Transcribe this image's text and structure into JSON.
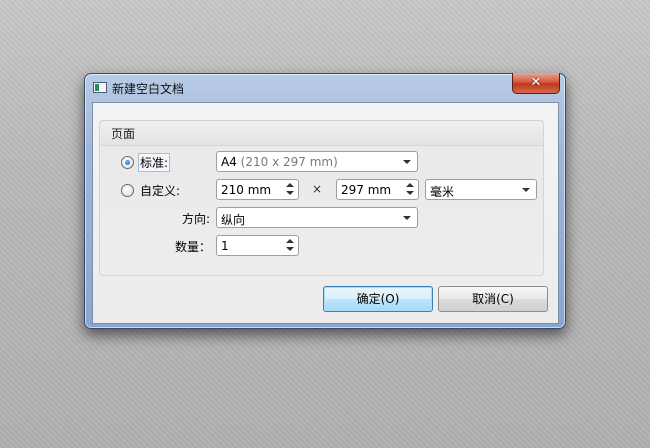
{
  "window": {
    "title": "新建空白文档",
    "close_symbol": "✕",
    "icons": {
      "app": "document-icon",
      "close": "close-icon"
    }
  },
  "group": {
    "title": "页面"
  },
  "standard": {
    "label": "标准:",
    "checked": true,
    "size_name": "A4",
    "size_detail": "(210 x 297 mm)"
  },
  "custom": {
    "label": "自定义:",
    "checked": false,
    "width": "210 mm",
    "times": "×",
    "height": "297 mm",
    "unit": "毫米"
  },
  "orientation": {
    "label": "方向:",
    "value": "纵向"
  },
  "count": {
    "label": "数量：",
    "value": "1"
  },
  "buttons": {
    "ok": "确定(O)",
    "cancel": "取消(C)"
  },
  "colors": {
    "title_bar": "#9fb7da",
    "close": "#c0391b",
    "default_button": "#bee6fd",
    "radio_dot": "#1f5fb8"
  }
}
